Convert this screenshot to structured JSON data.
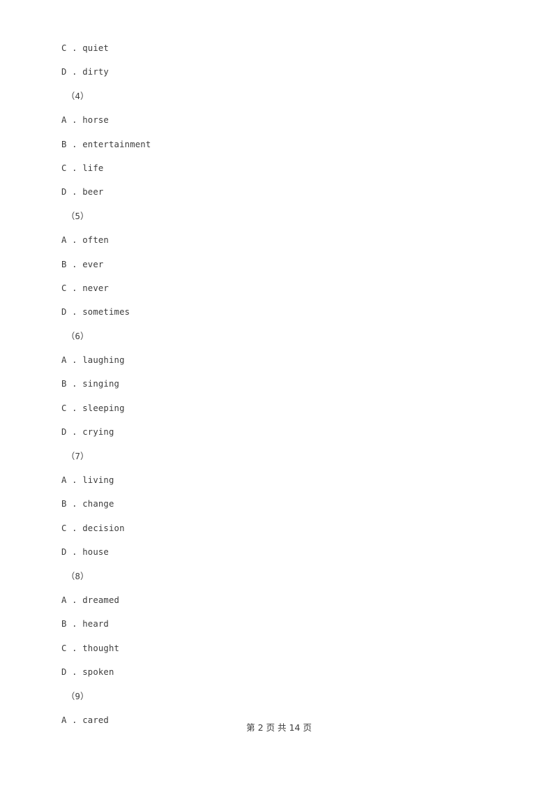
{
  "document": {
    "background_color": "#ffffff",
    "text_color": "#3d3d3d",
    "lines": [
      {
        "kind": "option",
        "text": "C . quiet"
      },
      {
        "kind": "option",
        "text": "D . dirty"
      },
      {
        "kind": "qnum",
        "text": "（4）"
      },
      {
        "kind": "option",
        "text": "A . horse"
      },
      {
        "kind": "option",
        "text": "B . entertainment"
      },
      {
        "kind": "option",
        "text": "C . life"
      },
      {
        "kind": "option",
        "text": "D . beer"
      },
      {
        "kind": "qnum",
        "text": "（5）"
      },
      {
        "kind": "option",
        "text": "A . often"
      },
      {
        "kind": "option",
        "text": "B . ever"
      },
      {
        "kind": "option",
        "text": "C . never"
      },
      {
        "kind": "option",
        "text": "D . sometimes"
      },
      {
        "kind": "qnum",
        "text": "（6）"
      },
      {
        "kind": "option",
        "text": "A . laughing"
      },
      {
        "kind": "option",
        "text": "B . singing"
      },
      {
        "kind": "option",
        "text": "C . sleeping"
      },
      {
        "kind": "option",
        "text": "D . crying"
      },
      {
        "kind": "qnum",
        "text": "（7）"
      },
      {
        "kind": "option",
        "text": "A . living"
      },
      {
        "kind": "option",
        "text": "B . change"
      },
      {
        "kind": "option",
        "text": "C . decision"
      },
      {
        "kind": "option",
        "text": "D . house"
      },
      {
        "kind": "qnum",
        "text": "（8）"
      },
      {
        "kind": "option",
        "text": "A . dreamed"
      },
      {
        "kind": "option",
        "text": "B . heard"
      },
      {
        "kind": "option",
        "text": "C . thought"
      },
      {
        "kind": "option",
        "text": "D . spoken"
      },
      {
        "kind": "qnum",
        "text": "（9）"
      },
      {
        "kind": "option",
        "text": "A . cared"
      }
    ]
  },
  "footer": {
    "page_label": "第 2 页 共 14 页",
    "current_page": 2,
    "total_pages": 14
  }
}
